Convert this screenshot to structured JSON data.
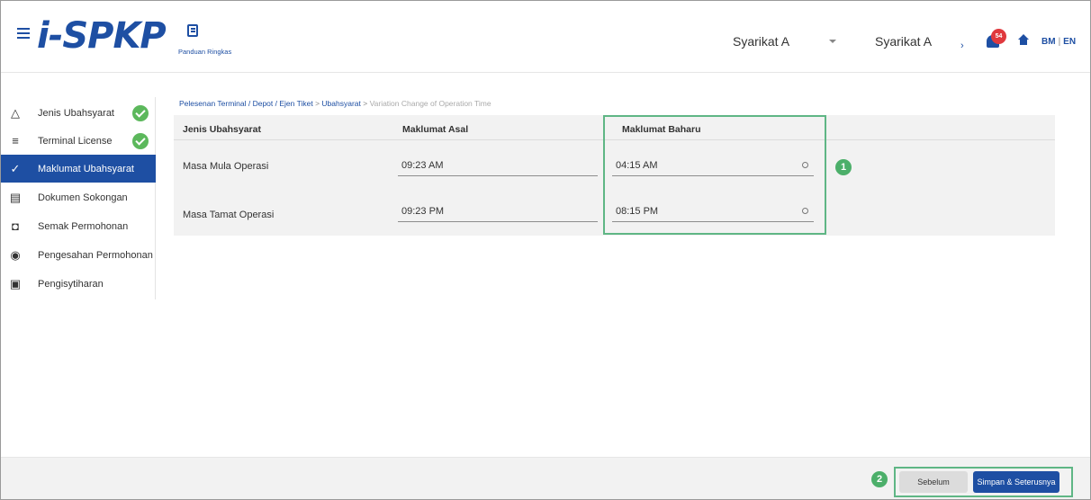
{
  "header": {
    "logo_text": "i-SPKP",
    "panduan_label": "Panduan Ringkas",
    "company_select": "Syarikat A",
    "company_name": "Syarikat A",
    "notification_count": "54",
    "lang_bm": "BM",
    "lang_sep": "|",
    "lang_en": "EN"
  },
  "sidebar": {
    "items": [
      {
        "label": "Jenis Ubahsyarat",
        "icon": "triangle-icon",
        "completed": true
      },
      {
        "label": "Terminal License",
        "icon": "filter-icon",
        "completed": true
      },
      {
        "label": "Maklumat Ubahsyarat",
        "icon": "edit-check-icon",
        "active": true
      },
      {
        "label": "Dokumen Sokongan",
        "icon": "documents-icon"
      },
      {
        "label": "Semak Permohonan",
        "icon": "review-icon"
      },
      {
        "label": "Pengesahan Permohonan",
        "icon": "verify-icon"
      },
      {
        "label": "Pengisytiharan",
        "icon": "clipboard-icon"
      }
    ]
  },
  "breadcrumb": {
    "part1": "Pelesenan Terminal / Depot / Ejen Tiket",
    "sep1": ">",
    "part2": "Ubahsyarat",
    "sep2": ">",
    "current": "Variation Change of Operation Time"
  },
  "table": {
    "headers": {
      "col1": "Jenis Ubahsyarat",
      "col2": "Maklumat Asal",
      "col3": "Maklumat Baharu"
    },
    "rows": [
      {
        "label": "Masa Mula Operasi",
        "original": "09:23 AM",
        "new": "04:15 AM"
      },
      {
        "label": "Masa Tamat Operasi",
        "original": "09:23 PM",
        "new": "08:15 PM"
      }
    ]
  },
  "markers": {
    "one": "1",
    "two": "2"
  },
  "footer": {
    "prev_label": "Sebelum",
    "next_label": "Simpan & Seterusnya"
  },
  "colors": {
    "primary": "#1e4fa3",
    "success": "#5cb85c",
    "highlight": "#5fb685",
    "badge": "#e0393e"
  }
}
